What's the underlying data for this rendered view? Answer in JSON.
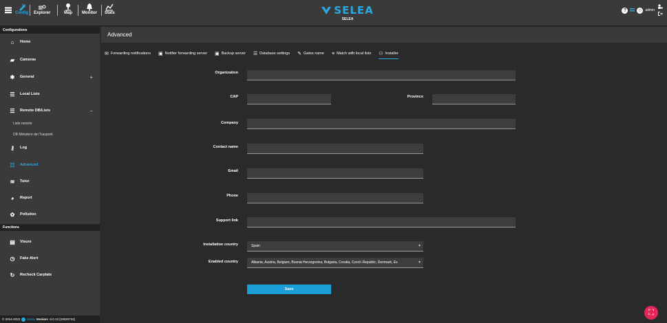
{
  "topnav": {
    "items": [
      {
        "label": "Config",
        "icon": "wrench-icon"
      },
      {
        "label": "Explorer",
        "icon": "explorer-icon"
      },
      {
        "label": "Map",
        "icon": "map-pin-icon"
      },
      {
        "label": "Monitor",
        "icon": "bell-icon"
      },
      {
        "label": "Stats",
        "icon": "stats-icon"
      }
    ]
  },
  "logo": {
    "text": "SELEA",
    "sub": "SELEA"
  },
  "user": {
    "name": "admin"
  },
  "sidebar": {
    "section_config": "Configurations",
    "items": [
      {
        "label": "Home",
        "icon": "home-icon"
      },
      {
        "label": "Cameras",
        "icon": "camera-icon"
      },
      {
        "label": "General",
        "icon": "gear-icon",
        "toggle": "+"
      },
      {
        "label": "Local Lists",
        "icon": "list-icon"
      },
      {
        "label": "Remote DB/Lists",
        "icon": "database-icon",
        "toggle": "−"
      },
      {
        "label": "Log",
        "icon": "key-icon"
      },
      {
        "label": "Advanced",
        "icon": "sliders-icon"
      },
      {
        "label": "Tutor",
        "icon": "tutor-icon"
      },
      {
        "label": "Report",
        "icon": "pie-chart-icon"
      },
      {
        "label": "Pollution",
        "icon": "pollution-icon"
      }
    ],
    "sub_items": [
      "Liste remote",
      "DB Ministero dei Trasporti"
    ],
    "section_functions": "Functions",
    "functions": [
      {
        "label": "Visure",
        "icon": "document-icon"
      },
      {
        "label": "Fake Alert",
        "icon": "clock-icon"
      },
      {
        "label": "Recheck Carplate",
        "icon": "refresh-icon"
      }
    ],
    "footer": {
      "copy": "© 2014-2023",
      "brand": "Selea",
      "version_label": "Version:",
      "version": "6.0.13 (23020724)"
    }
  },
  "page": {
    "title": "Advanced",
    "tabs": [
      {
        "label": "Forwarding notifications",
        "icon": "envelope-icon"
      },
      {
        "label": "Notifier forwarding server",
        "icon": "server-icon"
      },
      {
        "label": "Backup server",
        "icon": "backup-icon"
      },
      {
        "label": "Database settings",
        "icon": "database-icon"
      },
      {
        "label": "Gates name",
        "icon": "pencil-icon"
      },
      {
        "label": "Match with local lists",
        "icon": "list-check-icon"
      },
      {
        "label": "Installer",
        "icon": "users-gear-icon"
      }
    ]
  },
  "form": {
    "organization_label": "Organization",
    "organization_value": "",
    "cap_label": "CAP",
    "cap_value": "",
    "province_label": "Province",
    "province_value": "",
    "company_label": "Company",
    "company_value": "",
    "contact_label": "Contact name",
    "contact_value": "",
    "email_label": "Email",
    "email_value": "",
    "phone_label": "Phone",
    "phone_value": "",
    "support_label": "Support link",
    "support_value": "",
    "country_label": "Installation country",
    "country_value": "Spain",
    "enabled_label": "Enabled country",
    "enabled_value": "Albania, Austria, Belgium, Bosnia Herzegovina, Bulgaria, Croatia, Czech Republic, Denmark, Es",
    "save_label": "Save"
  },
  "colors": {
    "accent": "#2aa9e0",
    "fab": "#e5265a"
  }
}
